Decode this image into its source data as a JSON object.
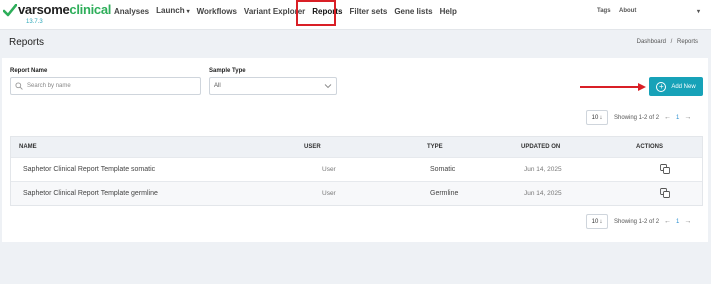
{
  "brand": {
    "logo_a": "varsome",
    "logo_b": "clinical",
    "version": "13.7.3"
  },
  "nav": {
    "items": [
      {
        "label": "Analyses"
      },
      {
        "label": "Launch"
      },
      {
        "label": "Workflows"
      },
      {
        "label": "Variant Explorer"
      },
      {
        "label": "Reports"
      },
      {
        "label": "Filter sets"
      },
      {
        "label": "Gene lists"
      },
      {
        "label": "Help"
      }
    ],
    "tags": "Tags",
    "about": "About"
  },
  "page": {
    "title": "Reports",
    "breadcrumb_home": "Dashboard",
    "breadcrumb_sep": "/",
    "breadcrumb_current": "Reports"
  },
  "filters": {
    "name_label": "Report Name",
    "name_placeholder": "Search by name",
    "type_label": "Sample Type",
    "type_value": "All"
  },
  "actions": {
    "add_new": "Add New"
  },
  "pagination": {
    "page_size": "10",
    "showing": "Showing 1-2 of 2",
    "current_page": "1"
  },
  "table": {
    "columns": [
      "NAME",
      "USER",
      "TYPE",
      "UPDATED ON",
      "ACTIONS"
    ],
    "rows": [
      {
        "name": "Saphetor Clinical Report Template somatic",
        "user": "User",
        "type": "Somatic",
        "updated": "Jun 14, 2025"
      },
      {
        "name": "Saphetor Clinical Report Template germline",
        "user": "User",
        "type": "Germline",
        "updated": "Jun 14, 2025"
      }
    ]
  },
  "colors": {
    "accent": "#17a2b8",
    "highlight": "#d91f26",
    "brand_green": "#2eae5a"
  }
}
